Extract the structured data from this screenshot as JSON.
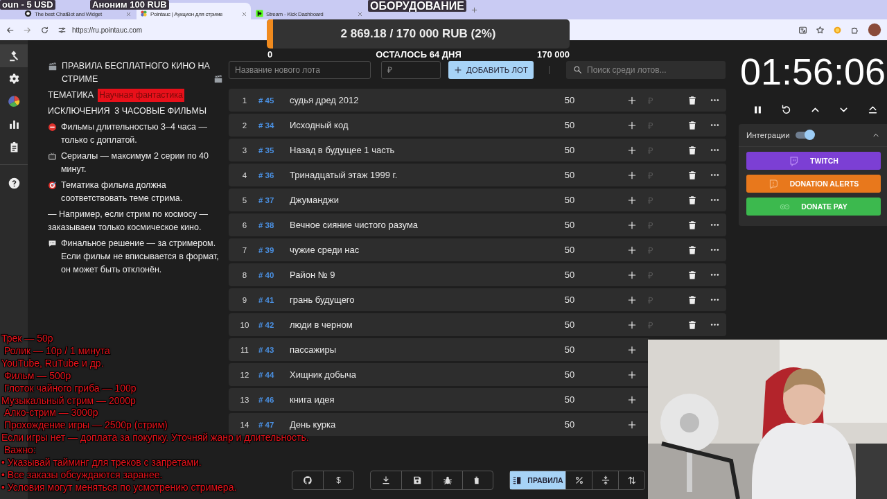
{
  "browser": {
    "tabs": [
      {
        "kind": "chatbot",
        "title": "The best ChatBot and Widget",
        "selected": false
      },
      {
        "kind": "pointauc",
        "title": "Pointauc | Аукцион для стриме",
        "selected": true
      },
      {
        "kind": "kick",
        "title": "Stream - Kick Dashboard",
        "selected": false
      }
    ],
    "url": "https://ru.pointauc.com"
  },
  "stream_alerts": [
    {
      "kind": "small",
      "text": "oun - 5 USD"
    },
    {
      "kind": "small",
      "text": "Аноним 100 RUB"
    },
    {
      "kind": "large",
      "text": "ОБОРУДОВАНИЕ"
    }
  ],
  "goal": {
    "text": "2 869.18 / 170 000 RUB (2%)",
    "level": 0.02,
    "min": "0",
    "remaining": "ОСТАЛОСЬ 64 ДНЯ",
    "max": "170 000"
  },
  "sidebar": {
    "items": [
      {
        "kind": "gavel",
        "selected": true
      },
      {
        "kind": "settings",
        "selected": false
      },
      {
        "kind": "pie",
        "selected": false
      },
      {
        "kind": "stats",
        "selected": false
      },
      {
        "kind": "clipboard",
        "selected": false
      },
      {
        "kind": "help",
        "selected": false
      }
    ]
  },
  "rules": {
    "title": "ПРАВИЛА БЕСПЛАТНОГО КИНО НА СТРИМЕ",
    "topic_label": "ТЕМАТИКА",
    "topic": "Научная фантастика",
    "exceptions": "ИСКЛЮЧЕНИЯ  3 ЧАСОВЫЕ ФИЛЬМЫ",
    "items": [
      {
        "kind": "no-entry",
        "text": "Фильмы длительностью 3–4 часа — только с доплатой."
      },
      {
        "kind": "tv",
        "text": "Сериалы — максимум 2 серии по 40 минут."
      },
      {
        "kind": "target",
        "text": "Тематика фильма должна соответствовать теме стрима."
      },
      {
        "kind": "plain",
        "text": "— Например, если стрим по космосу — заказываем только космическое кино."
      },
      {
        "kind": "speech",
        "text": "Финальное решение — за стримером. Если фильм не вписывается в формат, он может быть отклонён."
      }
    ]
  },
  "new_lot": {
    "name_placeholder": "Название нового лота",
    "amount_placeholder": "₽",
    "add_button": "ДОБАВИТЬ ЛОТ"
  },
  "search": {
    "placeholder": "Поиск среди лотов..."
  },
  "lots": [
    {
      "index": "1",
      "id": "# 45",
      "name": "судья дред 2012",
      "amount": "50",
      "actions": [
        {
          "kind": "add"
        },
        {
          "kind": "currency",
          "label": "₽"
        },
        {
          "kind": "delete"
        },
        {
          "kind": "more"
        }
      ]
    },
    {
      "index": "2",
      "id": "# 34",
      "name": "Исходный код",
      "amount": "50",
      "actions": [
        {
          "kind": "add"
        },
        {
          "kind": "currency",
          "label": "₽"
        },
        {
          "kind": "delete"
        },
        {
          "kind": "more"
        }
      ]
    },
    {
      "index": "3",
      "id": "# 35",
      "name": "Назад в будущее 1 часть",
      "amount": "50",
      "actions": [
        {
          "kind": "add"
        },
        {
          "kind": "currency",
          "label": "₽"
        },
        {
          "kind": "delete"
        },
        {
          "kind": "more"
        }
      ]
    },
    {
      "index": "4",
      "id": "# 36",
      "name": "Тринадцатый этаж 1999 г.",
      "amount": "50",
      "actions": [
        {
          "kind": "add"
        },
        {
          "kind": "currency",
          "label": "₽"
        },
        {
          "kind": "delete"
        },
        {
          "kind": "more"
        }
      ]
    },
    {
      "index": "5",
      "id": "# 37",
      "name": "Джуманджи",
      "amount": "50",
      "actions": [
        {
          "kind": "add"
        },
        {
          "kind": "currency",
          "label": "₽"
        },
        {
          "kind": "delete"
        },
        {
          "kind": "more"
        }
      ]
    },
    {
      "index": "6",
      "id": "# 38",
      "name": "Вечное сияние чистого разума",
      "amount": "50",
      "actions": [
        {
          "kind": "add"
        },
        {
          "kind": "currency",
          "label": "₽"
        },
        {
          "kind": "delete"
        },
        {
          "kind": "more"
        }
      ]
    },
    {
      "index": "7",
      "id": "# 39",
      "name": "чужие среди нас",
      "amount": "50",
      "actions": [
        {
          "kind": "add"
        },
        {
          "kind": "currency",
          "label": "₽"
        },
        {
          "kind": "delete"
        },
        {
          "kind": "more"
        }
      ]
    },
    {
      "index": "8",
      "id": "# 40",
      "name": "Район № 9",
      "amount": "50",
      "actions": [
        {
          "kind": "add"
        },
        {
          "kind": "currency",
          "label": "₽"
        },
        {
          "kind": "delete"
        },
        {
          "kind": "more"
        }
      ]
    },
    {
      "index": "9",
      "id": "# 41",
      "name": "грань будущего",
      "amount": "50",
      "actions": [
        {
          "kind": "add"
        },
        {
          "kind": "currency",
          "label": "₽"
        },
        {
          "kind": "delete"
        },
        {
          "kind": "more"
        }
      ]
    },
    {
      "index": "10",
      "id": "# 42",
      "name": "люди в черном",
      "amount": "50",
      "actions": [
        {
          "kind": "add"
        },
        {
          "kind": "currency",
          "label": "₽"
        },
        {
          "kind": "delete"
        },
        {
          "kind": "more"
        }
      ]
    },
    {
      "index": "11",
      "id": "# 43",
      "name": "пассажиры",
      "amount": "50",
      "actions": [
        {
          "kind": "add"
        }
      ]
    },
    {
      "index": "12",
      "id": "# 44",
      "name": "Хищник добыча",
      "amount": "50",
      "actions": [
        {
          "kind": "add"
        }
      ]
    },
    {
      "index": "13",
      "id": "# 46",
      "name": "книга идея",
      "amount": "50",
      "actions": [
        {
          "kind": "add"
        }
      ]
    },
    {
      "index": "14",
      "id": "# 47",
      "name": "День курка",
      "amount": "50",
      "actions": [
        {
          "kind": "add"
        }
      ]
    }
  ],
  "toolbar": {
    "groups": [
      [
        {
          "kind": "github",
          "selected": false
        },
        {
          "kind": "dollar",
          "label": "$",
          "selected": false
        }
      ],
      [
        {
          "kind": "download",
          "selected": false
        },
        {
          "kind": "save",
          "selected": false
        },
        {
          "kind": "bug",
          "selected": false
        },
        {
          "kind": "clear",
          "selected": false
        }
      ],
      [
        {
          "kind": "rules",
          "label": "ПРАВИЛА",
          "selected": true
        },
        {
          "kind": "percent",
          "selected": false
        },
        {
          "kind": "compress",
          "selected": false
        },
        {
          "kind": "sort",
          "selected": false
        }
      ]
    ]
  },
  "timer": {
    "time": "01:56:06",
    "controls": [
      {
        "kind": "pause"
      },
      {
        "kind": "restart"
      },
      {
        "kind": "up"
      },
      {
        "kind": "down"
      },
      {
        "kind": "collapse"
      }
    ]
  },
  "integrations": {
    "title": "Интеграции",
    "on": true,
    "expanded": true,
    "services": [
      {
        "kind": "twitch",
        "label": "TWITCH",
        "color": "#7c3fd4"
      },
      {
        "kind": "donationalerts",
        "label": "DONATION ALERTS",
        "color": "#e8781c"
      },
      {
        "kind": "donatepay",
        "label": "DONATE PAY",
        "color": "#3cb94e"
      }
    ]
  },
  "price_list": {
    "lines": [
      "Трек — 50р",
      " Ролик — 10р / 1 минута",
      "YouTube, RuTube и др.",
      " Фильм — 500р",
      " Глоток чайного гриба — 100р",
      "Музыкальный стрим — 2000р",
      " Алко-стрим — 3000р",
      " Прохождение игры — 2500р (стрим)",
      "Если игры нет — доплата за покупку. Уточняй жанр и длительность.",
      " Важно:",
      "• Указывай тайминг для треков с запретами.",
      "• Все заказы обсуждаются заранее.",
      "• Условия могут меняться по усмотрению стримера."
    ]
  }
}
